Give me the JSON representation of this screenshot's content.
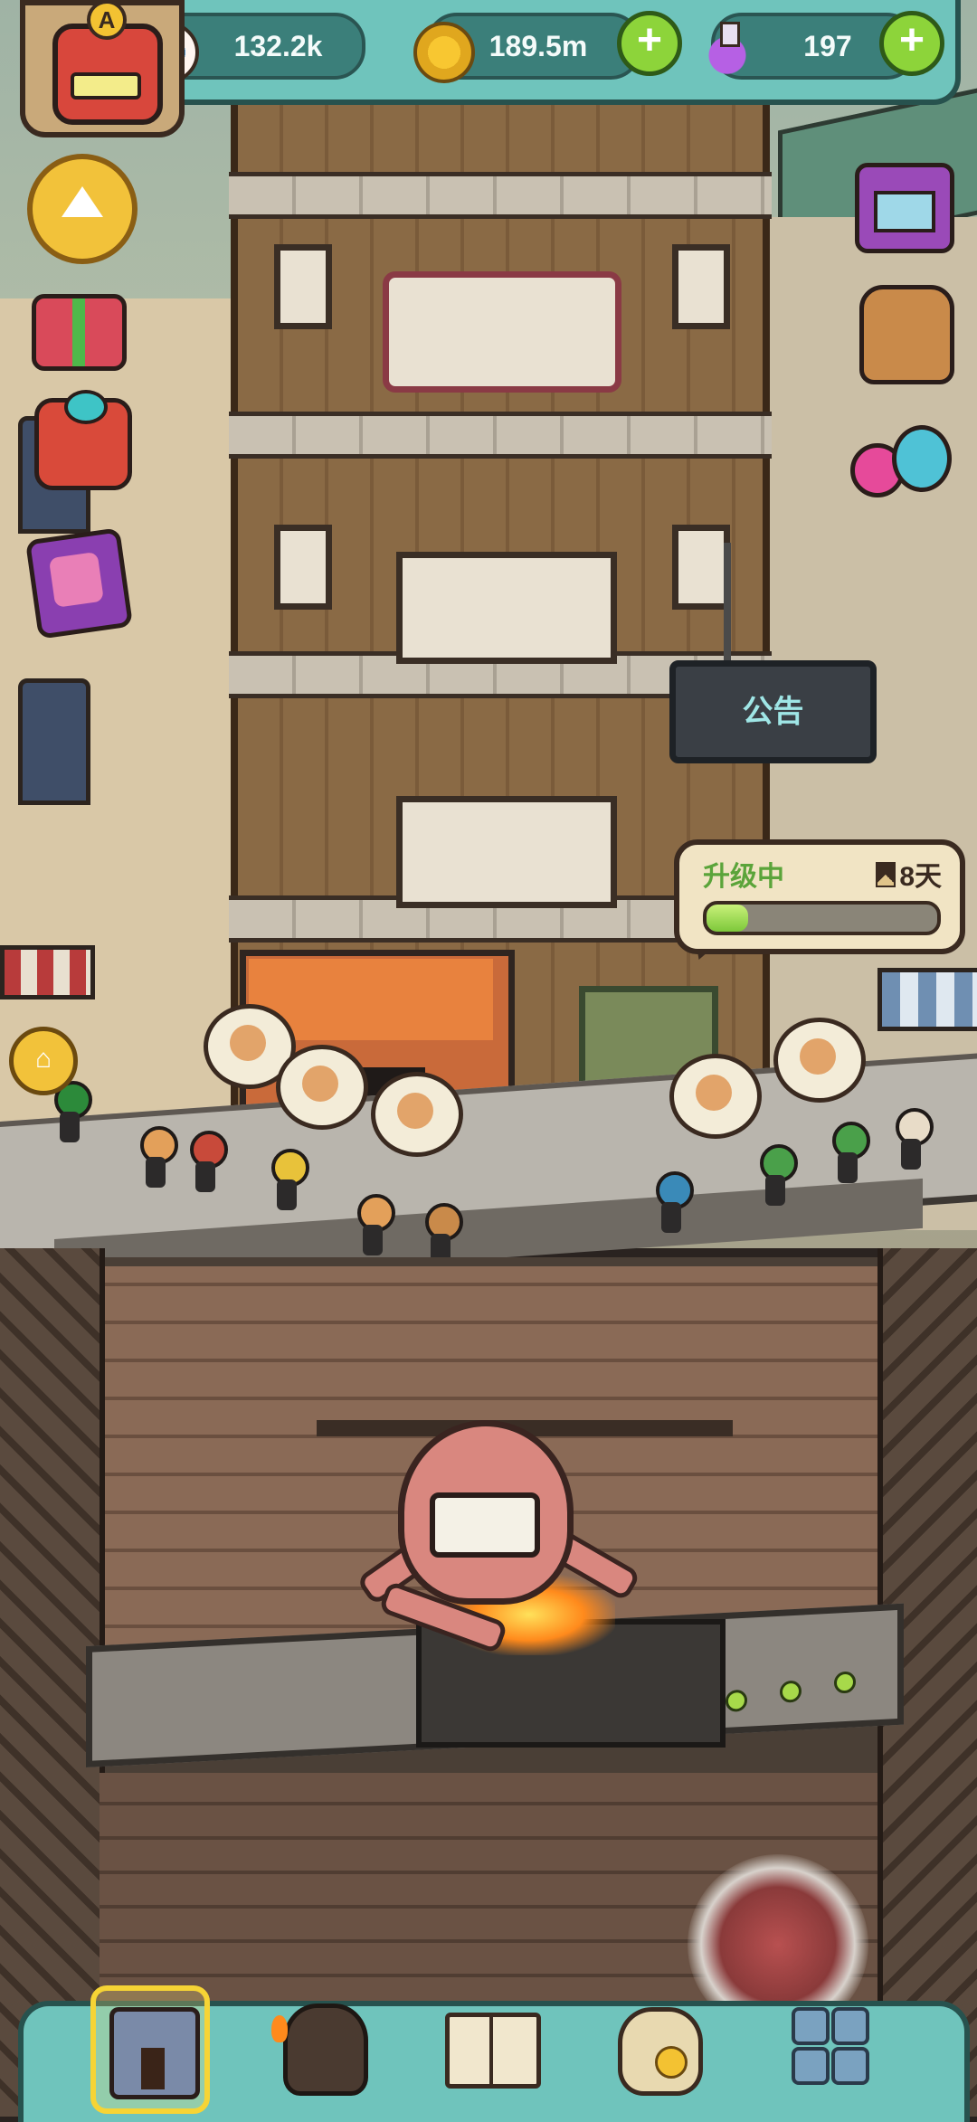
{
  "hud": {
    "avatar_letter": "A",
    "resources": [
      {
        "icon": "eyeball-icon",
        "value": "132.2k",
        "has_plus": false
      },
      {
        "icon": "gold-coin-icon",
        "value": "189.5m",
        "has_plus": true
      },
      {
        "icon": "potion-icon",
        "value": "197",
        "has_plus": true
      }
    ],
    "plus_symbol": "+"
  },
  "scene": {
    "notice_board": "公告",
    "upgrade": {
      "label": "升级中",
      "time_remaining": "8天",
      "progress": 0.18
    }
  },
  "side_menu_left": [
    "collapse-arrow-icon",
    "gift-box-icon",
    "present-icon",
    "cards-icon",
    "home-icon"
  ],
  "side_menu_right": [
    "tv-shop-icon",
    "backpack-icon",
    "eyeballs-icon"
  ],
  "bottom_nav": [
    {
      "icon": "building-icon",
      "active": true
    },
    {
      "icon": "monster-icon",
      "active": false
    },
    {
      "icon": "book-icon",
      "active": false
    },
    {
      "icon": "coin-bag-icon",
      "active": false
    },
    {
      "icon": "grid-menu-icon",
      "active": false
    }
  ],
  "colors": {
    "hud_teal": "#6fc4bc",
    "progress_green": "#7dc83a",
    "plus_green": "#8dd43a",
    "active_nav_border": "#f6d435"
  }
}
